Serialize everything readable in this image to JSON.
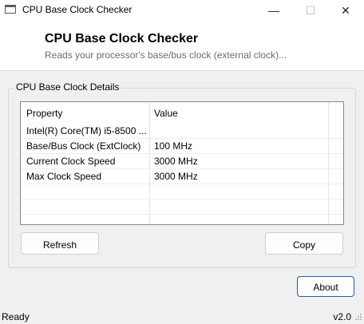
{
  "window": {
    "title": "CPU Base Clock Checker",
    "icon": "app-window-icon",
    "controls": {
      "minimize": "—",
      "maximize": "☐",
      "close": "✕"
    }
  },
  "header": {
    "title": "CPU Base Clock Checker",
    "subtitle": "Reads your processor's base/bus clock (external clock)..."
  },
  "details": {
    "group_label": "CPU Base Clock Details",
    "columns": [
      "Property",
      "Value"
    ],
    "rows": [
      {
        "property": "Intel(R) Core(TM) i5-8500 ...",
        "value": ""
      },
      {
        "property": "Base/Bus Clock (ExtClock)",
        "value": "100 MHz"
      },
      {
        "property": "Current Clock Speed",
        "value": "3000 MHz"
      },
      {
        "property": "Max Clock Speed",
        "value": "3000 MHz"
      }
    ]
  },
  "buttons": {
    "refresh": "Refresh",
    "copy": "Copy",
    "about": "About"
  },
  "status": {
    "text": "Ready",
    "version": "v2.0"
  }
}
